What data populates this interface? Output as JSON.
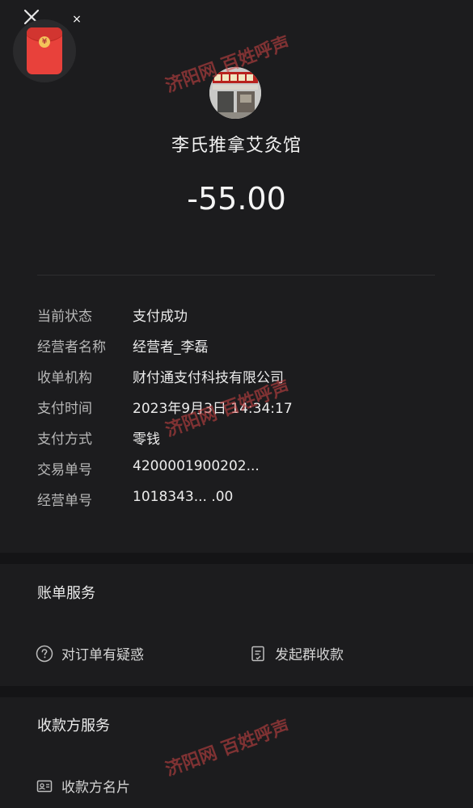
{
  "top": {
    "widget_close": "×"
  },
  "merchant": {
    "name": "李氏推拿艾灸馆",
    "amount": "-55.00"
  },
  "details": [
    {
      "label": "当前状态",
      "value": "支付成功"
    },
    {
      "label": "经营者名称",
      "value": "经营者_李磊"
    },
    {
      "label": "收单机构",
      "value": "财付通支付科技有限公司"
    },
    {
      "label": "支付时间",
      "value": "2023年9月3日 14:34:17"
    },
    {
      "label": "支付方式",
      "value": "零钱"
    },
    {
      "label": "交易单号",
      "value": "4200001900202..."
    },
    {
      "label": "经营单号",
      "value": "1018343... .00"
    }
  ],
  "bill_service": {
    "title": "账单服务",
    "question": "对订单有疑惑",
    "group_collect": "发起群收款"
  },
  "payee_service": {
    "title": "收款方服务",
    "card": "收款方名片"
  },
  "watermark": {
    "text": "济阳网 百姓呼声"
  },
  "colors": {
    "background": "#1c1c1e",
    "redpacket": "#e8413b",
    "watermark": "#d24646"
  }
}
